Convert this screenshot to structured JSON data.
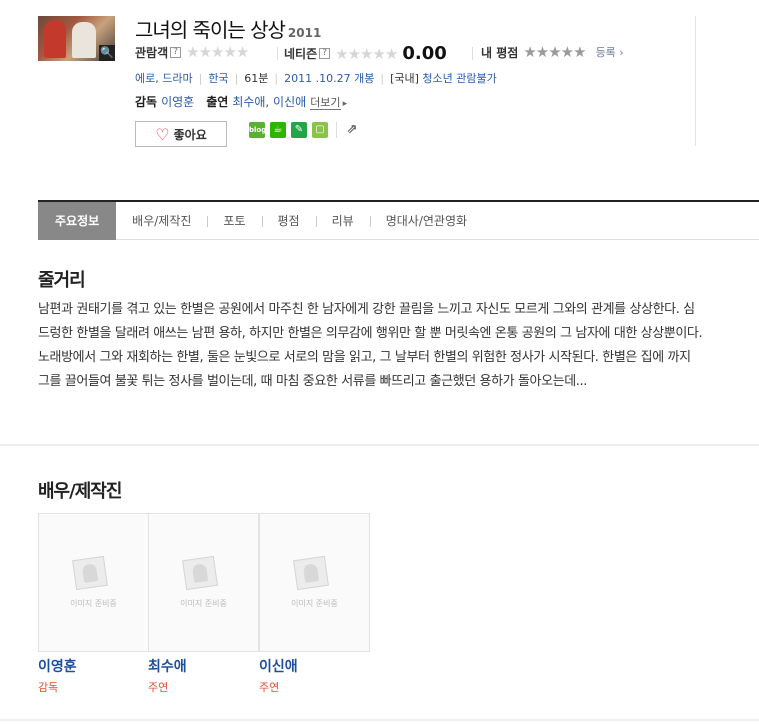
{
  "movie": {
    "title": "그녀의 죽이는 상상",
    "year": "2011"
  },
  "ratings": {
    "audience_label": "관람객",
    "netizen_label": "네티즌",
    "netizen_score": "0.00",
    "my_rating_label": "내 평점",
    "register_label": "등록",
    "help_glyph": "?",
    "stars": "★★★★★"
  },
  "meta": {
    "genre": "에로, 드라마",
    "country": "한국",
    "runtime": "61분",
    "release": "2011 .10.27 개봉",
    "rating_region": "[국내]",
    "rating": "청소년 관람불가"
  },
  "credits": {
    "director_label": "감독",
    "director": "이영훈",
    "cast_label": "출연",
    "cast": "최수애, 이신애",
    "more": "더보기"
  },
  "like_button": {
    "label": "좋아요"
  },
  "share": {
    "blog": "blog"
  },
  "tabs": [
    "주요정보",
    "배우/제작진",
    "포토",
    "평점",
    "리뷰",
    "명대사/연관영화"
  ],
  "synopsis": {
    "heading": "줄거리",
    "text": "남편과 권태기를 겪고 있는 한별은 공원에서 마주친 한 남자에게 강한 끌림을 느끼고 자신도 모르게 그와의 관계를 상상한다. 심드렁한 한별을 달래려 애쓰는 남편 용하, 하지만 한별은 의무감에 행위만 할 뿐 머릿속엔 온통 공원의 그 남자에 대한 상상뿐이다. 노래방에서 그와 재회하는 한별, 둘은 눈빛으로 서로의 맘을 읽고, 그 날부터 한별의 위험한 정사가 시작된다. 한별은 집에 까지 그를 끌어들여 불꽃 튀는 정사를 벌이는데, 때 마침 중요한 서류를 빠뜨리고 출근했던 용하가 돌아오는데..."
  },
  "cast_section": {
    "heading": "배우/제작진",
    "placeholder_caption": "이미지 준비중",
    "members": [
      {
        "name": "이영훈",
        "role": "감독"
      },
      {
        "name": "최수애",
        "role": "주연"
      },
      {
        "name": "이신애",
        "role": "주연"
      }
    ]
  },
  "colors": {
    "link": "#2a5ca8",
    "role": "#e05030",
    "active_tab": "#888888"
  }
}
